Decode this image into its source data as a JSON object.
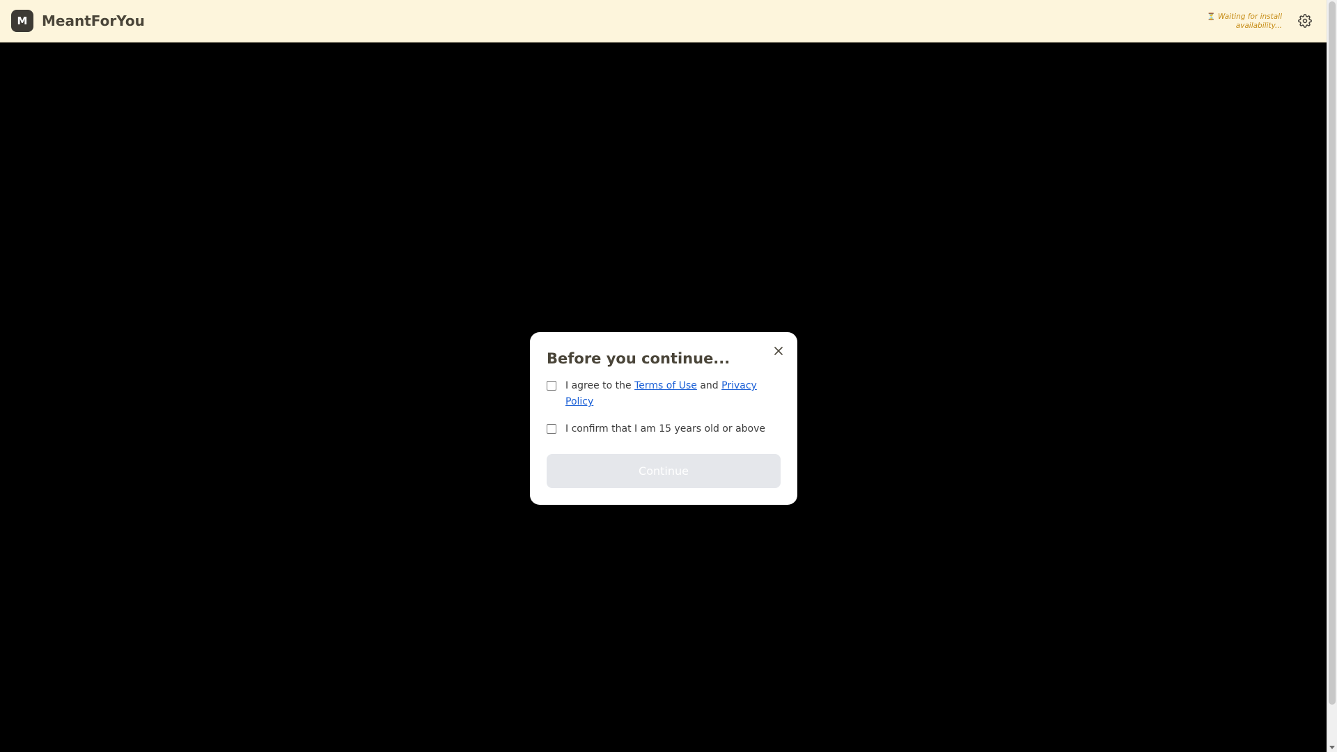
{
  "header": {
    "logo_letter": "M",
    "app_title": "MeantForYou",
    "install_status_icon": "hourglass-icon",
    "install_status_text": "Waiting for install availability...",
    "settings_icon": "gear-icon"
  },
  "modal": {
    "title": "Before you continue...",
    "close_icon": "close-icon",
    "terms_checkbox": {
      "checked": false,
      "prefix": "I agree to the ",
      "terms_link": "Terms of Use",
      "middle": " and ",
      "privacy_link": "Privacy Policy"
    },
    "age_checkbox": {
      "checked": false,
      "label": "I confirm that I am 15 years old or above"
    },
    "continue_label": "Continue",
    "continue_enabled": false
  },
  "colors": {
    "header_bg": "#fdf5dc",
    "backdrop": "#000000",
    "brand_dark": "#3d3a34",
    "status_text": "#c58a12",
    "link": "#1a5fd6",
    "disabled_button": "#e5e7eb"
  }
}
